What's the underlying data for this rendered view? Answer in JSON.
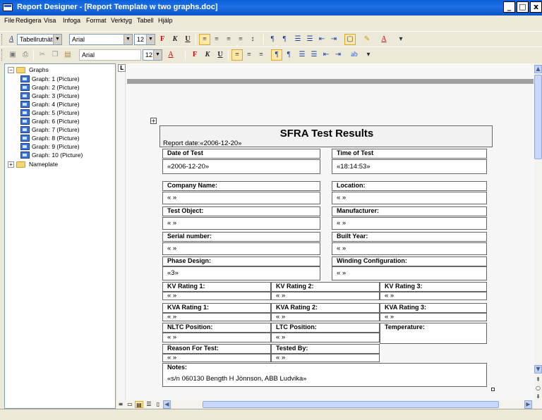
{
  "window": {
    "title": "Report Designer - [Report Template w two graphs.doc]",
    "min_btn": "_",
    "max_btn": "□",
    "close_btn": "x"
  },
  "menu": [
    "File",
    "Redigera",
    "Visa",
    "Infoga",
    "Format",
    "Verktyg",
    "Tabell",
    "Hjälp"
  ],
  "toolbar1": {
    "style_icon": "A",
    "style_value": "Tabellrutnät",
    "font_value": "Arial",
    "size_value": "12",
    "bold": "F",
    "italic": "K",
    "underline": "U"
  },
  "toolbar2": {
    "font_value": "Arial",
    "size_value": "12",
    "bold": "F",
    "italic": "K",
    "underline": "U"
  },
  "tree": {
    "root": "Graphs",
    "items": [
      "Graph: 1 (Picture)",
      "Graph: 2 (Picture)",
      "Graph: 3 (Picture)",
      "Graph: 4 (Picture)",
      "Graph: 5 (Picture)",
      "Graph: 6 (Picture)",
      "Graph: 7 (Picture)",
      "Graph: 8 (Picture)",
      "Graph: 9 (Picture)",
      "Graph: 10 (Picture)"
    ],
    "second": "Nameplate"
  },
  "report": {
    "title": "SFRA Test Results",
    "report_date": "Report date:«2006-12-20»",
    "date_of_test_label": "Date of Test",
    "date_of_test_value": "«2006-12-20»",
    "time_of_test_label": "Time of Test",
    "time_of_test_value": "«18:14:53»",
    "company_label": "Company Name:",
    "company_value": "« »",
    "location_label": "Location:",
    "location_value": "« »",
    "test_object_label": "Test Object:",
    "test_object_value": "« »",
    "manufacturer_label": "Manufacturer:",
    "manufacturer_value": "« »",
    "serial_label": "Serial number:",
    "serial_value": "« »",
    "built_year_label": "Built Year:",
    "built_year_value": "« »",
    "phase_label": "Phase Design:",
    "phase_value": "«3»",
    "winding_label": "Winding Configuration:",
    "winding_value": "« »",
    "kv1_label": "KV Rating 1:",
    "kv2_label": "KV Rating 2:",
    "kv3_label": "KV Rating 3:",
    "kva1_label": "KVA Rating 1:",
    "kva2_label": "KVA Rating 2:",
    "kva3_label": "KVA Rating 3:",
    "nltc_label": "NLTC Position:",
    "ltc_label": "LTC Position:",
    "temp_label": "Temperature:",
    "reason_label": "Reason For Test:",
    "tested_by_label": "Tested By:",
    "notes_label": "Notes:",
    "notes_value": "«s/n 060130 Bength H Jönnson, ABB Ludvika»",
    "empty_value": "« »"
  }
}
